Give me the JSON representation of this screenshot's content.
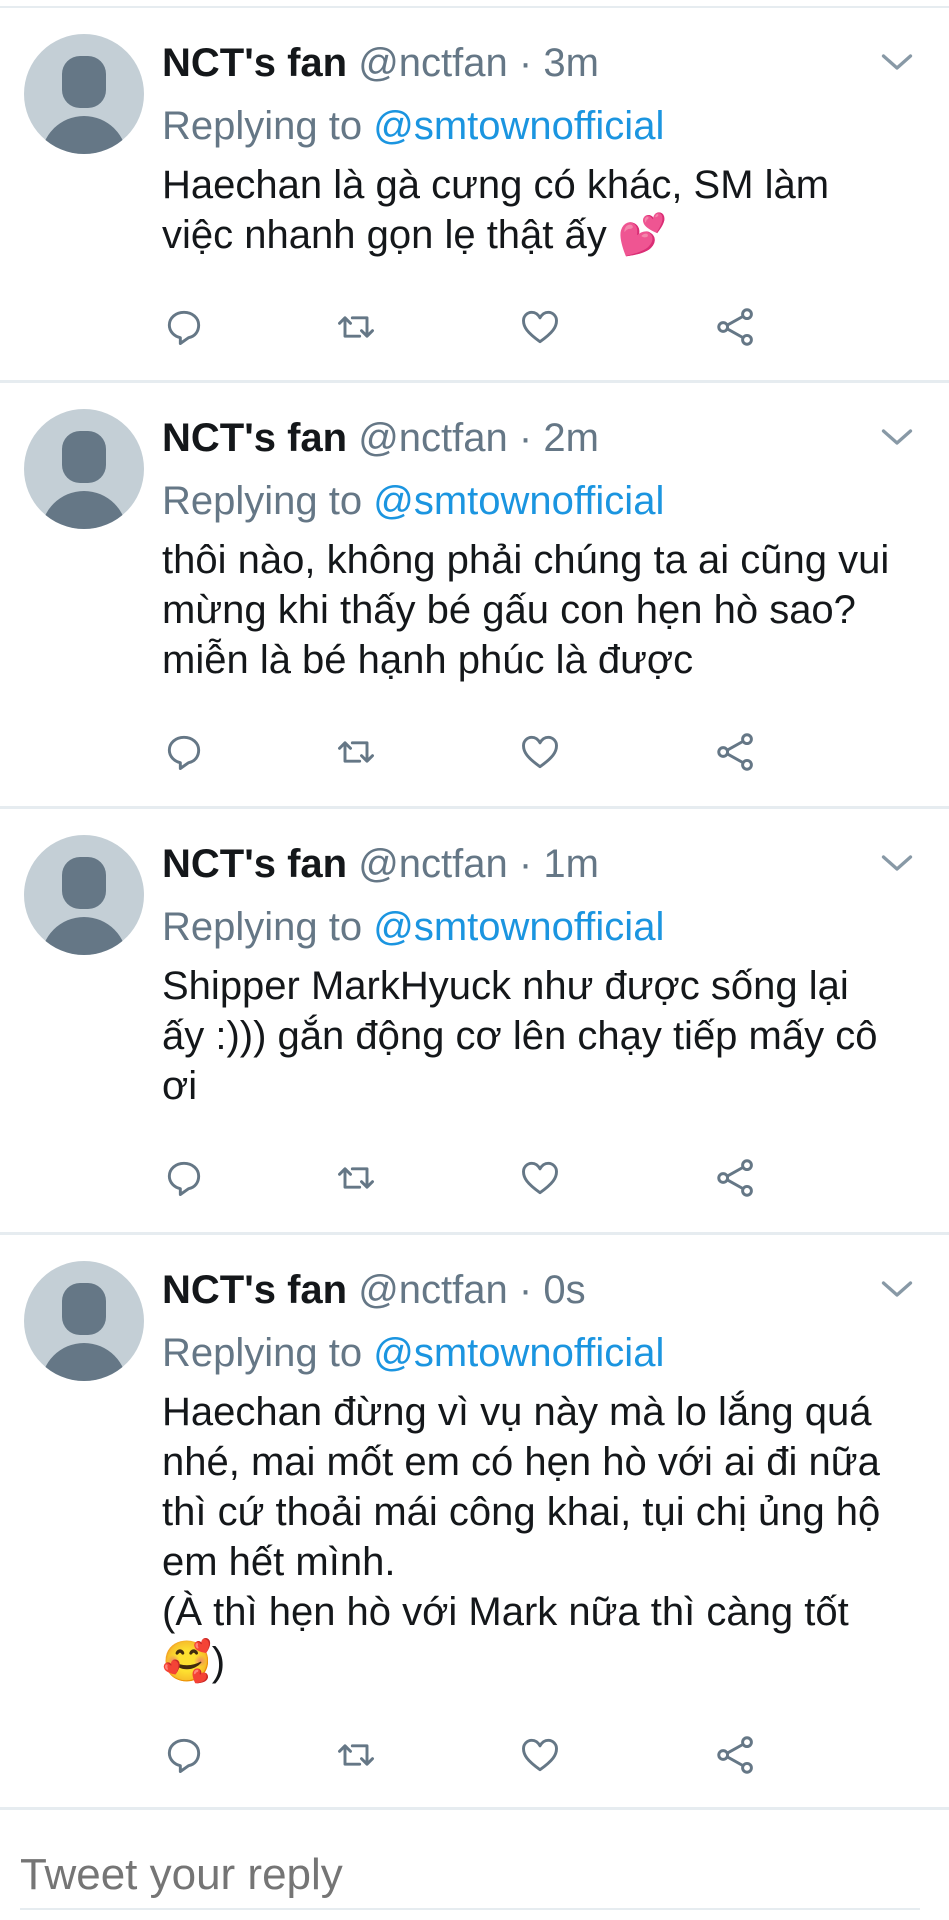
{
  "colors": {
    "accent": "#1b95e0",
    "secondary": "#657786",
    "border": "#e6ecf0"
  },
  "tweets": [
    {
      "name": "NCT's fan",
      "handle": "@nctfan",
      "separator": "·",
      "time": "3m",
      "replying_label": "Replying to",
      "mention": "@smtownofficial",
      "lines": [
        "Haechan là gà cưng có khác, SM làm",
        "việc nhanh gọn lẹ thật ấy 💕"
      ]
    },
    {
      "name": "NCT's fan",
      "handle": "@nctfan",
      "separator": "·",
      "time": "2m",
      "replying_label": "Replying to",
      "mention": "@smtownofficial",
      "lines": [
        "thôi nào, không phải chúng ta ai cũng vui",
        "mừng khi thấy bé gấu con hẹn hò sao?",
        "miễn là bé hạnh phúc là được"
      ]
    },
    {
      "name": "NCT's fan",
      "handle": "@nctfan",
      "separator": "·",
      "time": "1m",
      "replying_label": "Replying to",
      "mention": "@smtownofficial",
      "lines": [
        "Shipper MarkHyuck như được sống lại",
        "ấy :))) gắn động cơ lên chạy tiếp mấy cô",
        "ơi"
      ]
    },
    {
      "name": "NCT's fan",
      "handle": "@nctfan",
      "separator": "·",
      "time": "0s",
      "replying_label": "Replying to",
      "mention": "@smtownofficial",
      "lines": [
        "Haechan đừng vì vụ này mà lo lắng quá",
        "nhé, mai mốt em có hẹn hò với ai đi nữa",
        "thì cứ thoải mái công khai, tụi chị ủng hộ",
        "em hết mình.",
        "(À thì hẹn hò với Mark nữa thì càng tốt",
        "🥰)"
      ]
    }
  ],
  "icons": [
    "chevron-down-icon",
    "reply-icon",
    "retweet-icon",
    "like-icon",
    "share-icon"
  ],
  "compose": {
    "placeholder": "Tweet your reply"
  }
}
